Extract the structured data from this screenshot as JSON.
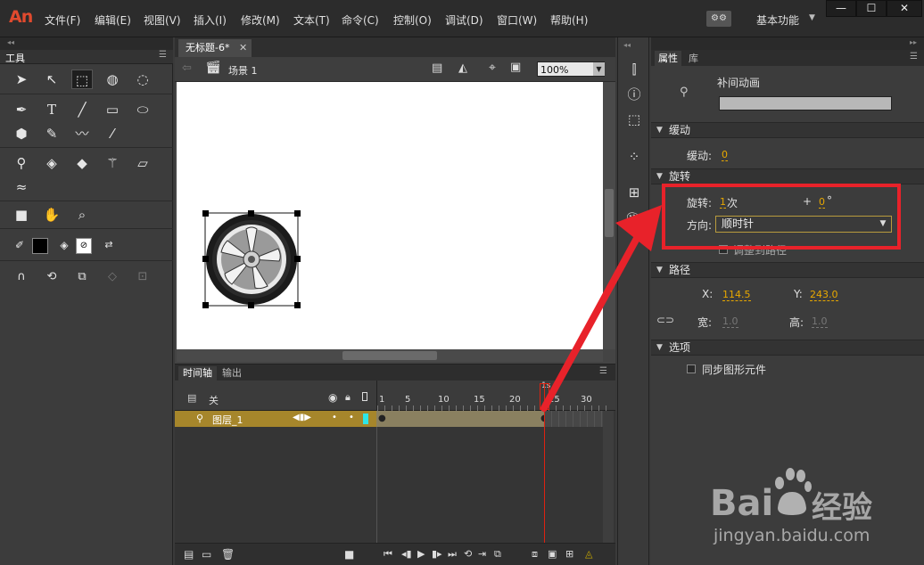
{
  "app": {
    "logo": "An",
    "menus": [
      "文件(F)",
      "编辑(E)",
      "视图(V)",
      "插入(I)",
      "修改(M)",
      "文本(T)",
      "命令(C)",
      "控制(O)",
      "调试(D)",
      "窗口(W)",
      "帮助(H)"
    ],
    "workspace_label": "基本功能",
    "window_buttons": [
      "—",
      "☐",
      "✕"
    ]
  },
  "tools": {
    "tab_label": "工具"
  },
  "document": {
    "tab_label": "无标题-6*",
    "scene_label": "场景 1",
    "zoom": "100%"
  },
  "timeline": {
    "tabs": [
      "时间轴",
      "输出"
    ],
    "header_label": "关",
    "frame_numbers": [
      "1",
      "5",
      "10",
      "15",
      "20",
      "25",
      "30"
    ],
    "playhead_label": "1s",
    "layer_name": "图层_1"
  },
  "properties": {
    "tabs": [
      "属性",
      "库"
    ],
    "object_type": "补间动画",
    "sections": {
      "easing": "缓动",
      "rotation": "旋转",
      "path": "路径",
      "options": "选项"
    },
    "easing_label": "缓动:",
    "easing_value": "0",
    "rotation_label": "旋转:",
    "rotation_count": "1",
    "rotation_unit": "次",
    "plus": "+",
    "rotation_degrees": "0",
    "degree_symbol": "°",
    "direction_label": "方向:",
    "direction_value": "顺时针",
    "orient_to_path": "调整到路径",
    "x_label": "X:",
    "x_value": "114.5",
    "y_label": "Y:",
    "y_value": "243.0",
    "width_label": "宽:",
    "width_value": "1.0",
    "height_label": "高:",
    "height_value": "1.0",
    "sync_symbols": "同步图形元件"
  },
  "watermark": {
    "brand": "Bai",
    "brand_cn": "经验",
    "url": "jingyan.baidu.com"
  },
  "colors": {
    "accent_red": "#e8222a",
    "value_orange": "#e8a800",
    "layer_gold": "#a6862b"
  }
}
